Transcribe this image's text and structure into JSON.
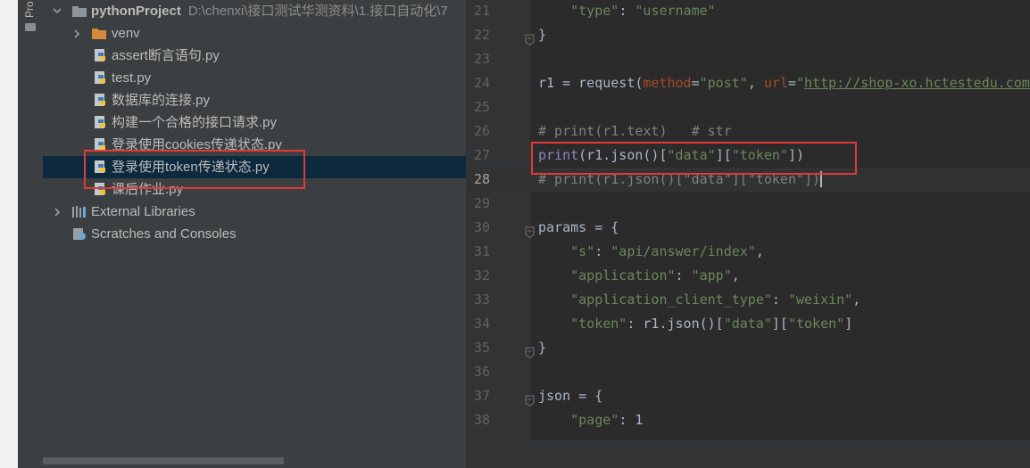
{
  "colors": {
    "project_bg": "#3c3f41",
    "editor_bg": "#2b2b2b",
    "selection": "#0d293e",
    "highlight_box": "#e03a3a",
    "string": "#6a8759",
    "comment": "#808080",
    "param": "#aa4926",
    "builtin": "#8888c6"
  },
  "toolwindow": {
    "label": "Pro"
  },
  "project_tree": {
    "root": {
      "name": "pythonProject",
      "path": "D:\\chenxi\\接口测试华测资料\\1.接口自动化\\7",
      "icon": "folder-icon"
    },
    "items": [
      {
        "name": "venv",
        "icon": "folder-orange-icon"
      },
      {
        "name": "assert断言语句.py",
        "icon": "python-file-icon"
      },
      {
        "name": "test.py",
        "icon": "python-file-icon"
      },
      {
        "name": "数据库的连接.py",
        "icon": "python-file-icon"
      },
      {
        "name": "构建一个合格的接口请求.py",
        "icon": "python-file-icon"
      },
      {
        "name": "登录使用cookies传递状态.py",
        "icon": "python-file-icon"
      },
      {
        "name": "登录使用token传递状态.py",
        "icon": "python-file-icon",
        "selected": true
      },
      {
        "name": "课后作业.py",
        "icon": "python-file-icon"
      }
    ],
    "external_libraries": "External Libraries",
    "scratches": "Scratches and Consoles"
  },
  "editor": {
    "current_line": 28,
    "lines": [
      {
        "n": "21",
        "tokens": [
          [
            "    ",
            "p"
          ],
          [
            "\"type\"",
            "s"
          ],
          [
            ": ",
            "p"
          ],
          [
            "\"username\"",
            "s"
          ]
        ]
      },
      {
        "n": "22",
        "fold": true,
        "tokens": [
          [
            "}",
            "p"
          ]
        ]
      },
      {
        "n": "23",
        "tokens": []
      },
      {
        "n": "24",
        "tokens": [
          [
            "r1 = request(",
            "p"
          ],
          [
            "method",
            "k"
          ],
          [
            "=",
            "p"
          ],
          [
            "\"post\"",
            "s"
          ],
          [
            ", ",
            "p"
          ],
          [
            "url",
            "k"
          ],
          [
            "=",
            "p"
          ],
          [
            "\"",
            "s"
          ],
          [
            "http://shop-xo.hctestedu.com",
            "u"
          ]
        ]
      },
      {
        "n": "25",
        "tokens": []
      },
      {
        "n": "26",
        "tokens": [
          [
            "# print(r1.text)   # str",
            "c"
          ]
        ]
      },
      {
        "n": "27",
        "tokens": [
          [
            "print",
            "b"
          ],
          [
            "(r1.json()[",
            "p"
          ],
          [
            "\"data\"",
            "s"
          ],
          [
            "][",
            "p"
          ],
          [
            "\"token\"",
            "s"
          ],
          [
            "])",
            "p"
          ]
        ]
      },
      {
        "n": "28",
        "caret": true,
        "tokens": [
          [
            "# print(r1.json()[\"data\"][\"token\"])",
            "c"
          ]
        ]
      },
      {
        "n": "29",
        "tokens": []
      },
      {
        "n": "30",
        "fold": true,
        "tokens": [
          [
            "params = {",
            "p"
          ]
        ]
      },
      {
        "n": "31",
        "tokens": [
          [
            "    ",
            "p"
          ],
          [
            "\"s\"",
            "s"
          ],
          [
            ": ",
            "p"
          ],
          [
            "\"api/answer/index\"",
            "s"
          ],
          [
            ",",
            "p"
          ]
        ]
      },
      {
        "n": "32",
        "tokens": [
          [
            "    ",
            "p"
          ],
          [
            "\"application\"",
            "s"
          ],
          [
            ": ",
            "p"
          ],
          [
            "\"app\"",
            "s"
          ],
          [
            ",",
            "p"
          ]
        ]
      },
      {
        "n": "33",
        "tokens": [
          [
            "    ",
            "p"
          ],
          [
            "\"application_client_type\"",
            "s"
          ],
          [
            ": ",
            "p"
          ],
          [
            "\"weixin\"",
            "s"
          ],
          [
            ",",
            "p"
          ]
        ]
      },
      {
        "n": "34",
        "tokens": [
          [
            "    ",
            "p"
          ],
          [
            "\"token\"",
            "s"
          ],
          [
            ": r1.json()[",
            "p"
          ],
          [
            "\"data\"",
            "s"
          ],
          [
            "][",
            "p"
          ],
          [
            "\"token\"",
            "s"
          ],
          [
            "]",
            "p"
          ]
        ]
      },
      {
        "n": "35",
        "fold": true,
        "tokens": [
          [
            "}",
            "p"
          ]
        ]
      },
      {
        "n": "36",
        "tokens": []
      },
      {
        "n": "37",
        "fold": true,
        "tokens": [
          [
            "json = {",
            "p"
          ]
        ]
      },
      {
        "n": "38",
        "tokens": [
          [
            "    ",
            "p"
          ],
          [
            "\"page\"",
            "s"
          ],
          [
            ": ",
            "p"
          ],
          [
            "1",
            "p"
          ]
        ]
      }
    ]
  }
}
